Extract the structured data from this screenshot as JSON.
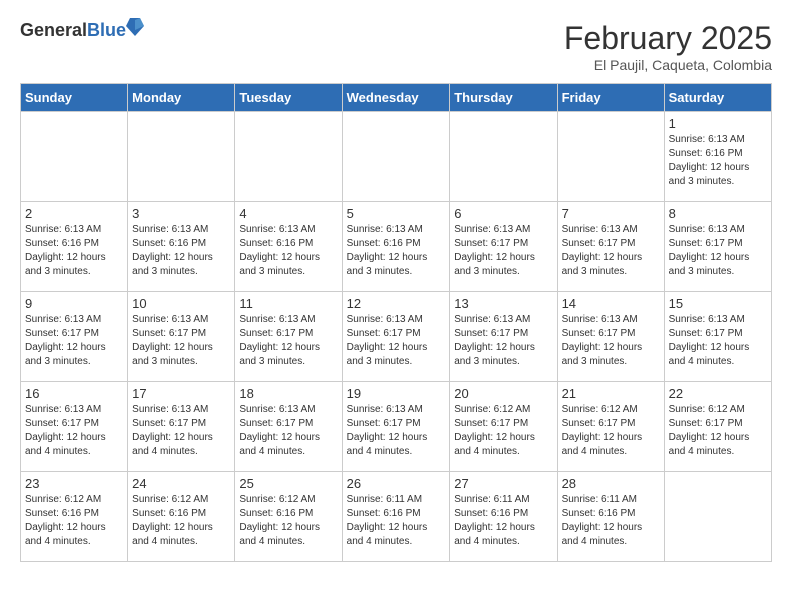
{
  "logo": {
    "general": "General",
    "blue": "Blue"
  },
  "header": {
    "month": "February 2025",
    "location": "El Paujil, Caqueta, Colombia"
  },
  "weekdays": [
    "Sunday",
    "Monday",
    "Tuesday",
    "Wednesday",
    "Thursday",
    "Friday",
    "Saturday"
  ],
  "weeks": [
    [
      {
        "day": "",
        "info": ""
      },
      {
        "day": "",
        "info": ""
      },
      {
        "day": "",
        "info": ""
      },
      {
        "day": "",
        "info": ""
      },
      {
        "day": "",
        "info": ""
      },
      {
        "day": "",
        "info": ""
      },
      {
        "day": "1",
        "info": "Sunrise: 6:13 AM\nSunset: 6:16 PM\nDaylight: 12 hours\nand 3 minutes."
      }
    ],
    [
      {
        "day": "2",
        "info": "Sunrise: 6:13 AM\nSunset: 6:16 PM\nDaylight: 12 hours\nand 3 minutes."
      },
      {
        "day": "3",
        "info": "Sunrise: 6:13 AM\nSunset: 6:16 PM\nDaylight: 12 hours\nand 3 minutes."
      },
      {
        "day": "4",
        "info": "Sunrise: 6:13 AM\nSunset: 6:16 PM\nDaylight: 12 hours\nand 3 minutes."
      },
      {
        "day": "5",
        "info": "Sunrise: 6:13 AM\nSunset: 6:16 PM\nDaylight: 12 hours\nand 3 minutes."
      },
      {
        "day": "6",
        "info": "Sunrise: 6:13 AM\nSunset: 6:17 PM\nDaylight: 12 hours\nand 3 minutes."
      },
      {
        "day": "7",
        "info": "Sunrise: 6:13 AM\nSunset: 6:17 PM\nDaylight: 12 hours\nand 3 minutes."
      },
      {
        "day": "8",
        "info": "Sunrise: 6:13 AM\nSunset: 6:17 PM\nDaylight: 12 hours\nand 3 minutes."
      }
    ],
    [
      {
        "day": "9",
        "info": "Sunrise: 6:13 AM\nSunset: 6:17 PM\nDaylight: 12 hours\nand 3 minutes."
      },
      {
        "day": "10",
        "info": "Sunrise: 6:13 AM\nSunset: 6:17 PM\nDaylight: 12 hours\nand 3 minutes."
      },
      {
        "day": "11",
        "info": "Sunrise: 6:13 AM\nSunset: 6:17 PM\nDaylight: 12 hours\nand 3 minutes."
      },
      {
        "day": "12",
        "info": "Sunrise: 6:13 AM\nSunset: 6:17 PM\nDaylight: 12 hours\nand 3 minutes."
      },
      {
        "day": "13",
        "info": "Sunrise: 6:13 AM\nSunset: 6:17 PM\nDaylight: 12 hours\nand 3 minutes."
      },
      {
        "day": "14",
        "info": "Sunrise: 6:13 AM\nSunset: 6:17 PM\nDaylight: 12 hours\nand 3 minutes."
      },
      {
        "day": "15",
        "info": "Sunrise: 6:13 AM\nSunset: 6:17 PM\nDaylight: 12 hours\nand 4 minutes."
      }
    ],
    [
      {
        "day": "16",
        "info": "Sunrise: 6:13 AM\nSunset: 6:17 PM\nDaylight: 12 hours\nand 4 minutes."
      },
      {
        "day": "17",
        "info": "Sunrise: 6:13 AM\nSunset: 6:17 PM\nDaylight: 12 hours\nand 4 minutes."
      },
      {
        "day": "18",
        "info": "Sunrise: 6:13 AM\nSunset: 6:17 PM\nDaylight: 12 hours\nand 4 minutes."
      },
      {
        "day": "19",
        "info": "Sunrise: 6:13 AM\nSunset: 6:17 PM\nDaylight: 12 hours\nand 4 minutes."
      },
      {
        "day": "20",
        "info": "Sunrise: 6:12 AM\nSunset: 6:17 PM\nDaylight: 12 hours\nand 4 minutes."
      },
      {
        "day": "21",
        "info": "Sunrise: 6:12 AM\nSunset: 6:17 PM\nDaylight: 12 hours\nand 4 minutes."
      },
      {
        "day": "22",
        "info": "Sunrise: 6:12 AM\nSunset: 6:17 PM\nDaylight: 12 hours\nand 4 minutes."
      }
    ],
    [
      {
        "day": "23",
        "info": "Sunrise: 6:12 AM\nSunset: 6:16 PM\nDaylight: 12 hours\nand 4 minutes."
      },
      {
        "day": "24",
        "info": "Sunrise: 6:12 AM\nSunset: 6:16 PM\nDaylight: 12 hours\nand 4 minutes."
      },
      {
        "day": "25",
        "info": "Sunrise: 6:12 AM\nSunset: 6:16 PM\nDaylight: 12 hours\nand 4 minutes."
      },
      {
        "day": "26",
        "info": "Sunrise: 6:11 AM\nSunset: 6:16 PM\nDaylight: 12 hours\nand 4 minutes."
      },
      {
        "day": "27",
        "info": "Sunrise: 6:11 AM\nSunset: 6:16 PM\nDaylight: 12 hours\nand 4 minutes."
      },
      {
        "day": "28",
        "info": "Sunrise: 6:11 AM\nSunset: 6:16 PM\nDaylight: 12 hours\nand 4 minutes."
      },
      {
        "day": "",
        "info": ""
      }
    ]
  ]
}
